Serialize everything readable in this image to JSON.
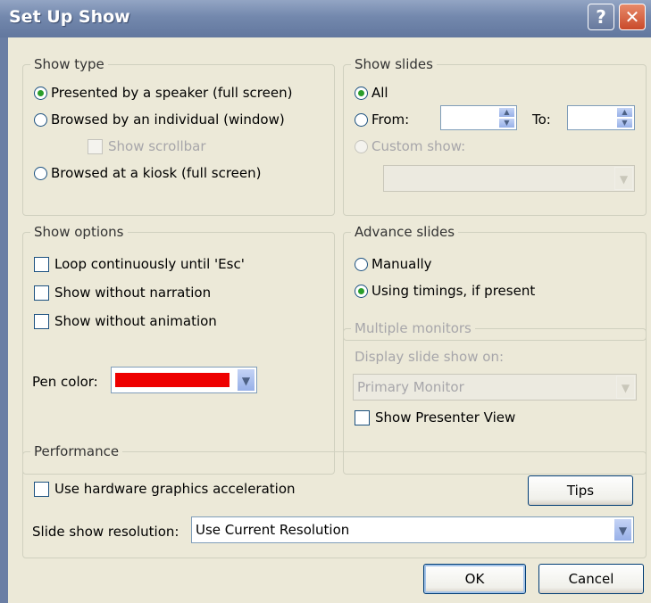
{
  "window": {
    "title": "Set Up Show",
    "help_glyph": "?",
    "close_glyph": "✕"
  },
  "show_type": {
    "legend": "Show type",
    "options": [
      "Presented by a speaker (full screen)",
      "Browsed by an individual (window)",
      "Browsed at a kiosk (full screen)"
    ],
    "selected": 0,
    "scrollbar_label": "Show scrollbar"
  },
  "show_slides": {
    "legend": "Show slides",
    "all_label": "All",
    "from_label": "From:",
    "from_value": "",
    "to_label": "To:",
    "to_value": "",
    "custom_label": "Custom show:",
    "custom_value": "",
    "selected": "All"
  },
  "show_options": {
    "legend": "Show options",
    "checks": [
      {
        "label": "Loop continuously until 'Esc'",
        "checked": false
      },
      {
        "label": "Show without narration",
        "checked": false
      },
      {
        "label": "Show without animation",
        "checked": false
      }
    ],
    "pen_label": "Pen color:",
    "pen_color": "#ee0000"
  },
  "advance_slides": {
    "legend": "Advance slides",
    "options": [
      "Manually",
      "Using timings, if present"
    ],
    "selected": 1
  },
  "multiple_monitors": {
    "legend": "Multiple monitors",
    "display_label": "Display slide show on:",
    "display_value": "Primary Monitor",
    "presenter_label": "Show Presenter View",
    "presenter_checked": false
  },
  "performance": {
    "legend": "Performance",
    "hw_label": "Use hardware graphics acceleration",
    "hw_checked": false,
    "tips_label": "Tips",
    "resolution_label": "Slide show resolution:",
    "resolution_value": "Use Current Resolution"
  },
  "buttons": {
    "ok": "OK",
    "cancel": "Cancel"
  },
  "icons": {
    "dropdown": "▼",
    "spin_up": "▲",
    "spin_down": "▼"
  }
}
